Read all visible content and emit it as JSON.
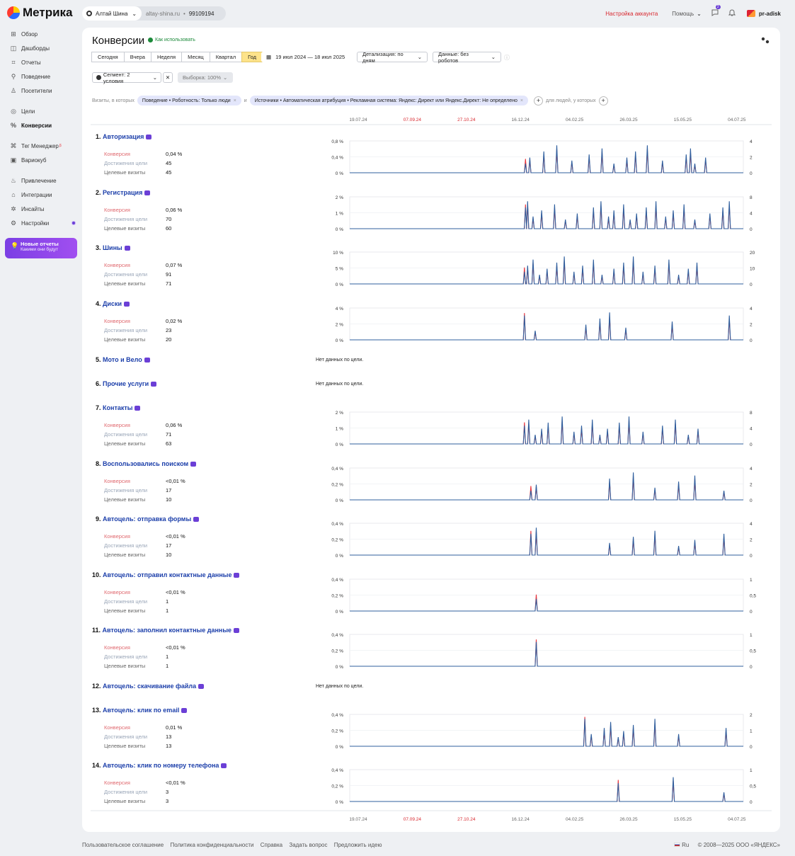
{
  "app": {
    "name": "Метрика"
  },
  "counter": {
    "name": "Алтай Шина",
    "domain": "altay-shina.ru",
    "id": "99109194"
  },
  "top": {
    "account_settings": "Настройка аккаунта",
    "help": "Помощь",
    "notif_count": "2",
    "user": "pr-adisk"
  },
  "sidebar": {
    "items": [
      {
        "label": "Обзор",
        "icon": "grid-icon"
      },
      {
        "label": "Дашборды",
        "icon": "dashboard-icon"
      },
      {
        "label": "Отчеты",
        "icon": "reports-icon"
      },
      {
        "label": "Поведение",
        "icon": "behavior-icon"
      },
      {
        "label": "Посетители",
        "icon": "visitors-icon"
      },
      {
        "label": "Цели",
        "icon": "target-icon"
      },
      {
        "label": "Конверсии",
        "icon": "percent-icon"
      },
      {
        "label": "Тег Менеджер",
        "icon": "tag-icon"
      },
      {
        "label": "Вариокуб",
        "icon": "cube-icon"
      },
      {
        "label": "Привлечение",
        "icon": "flame-icon"
      },
      {
        "label": "Интеграции",
        "icon": "integrations-icon"
      },
      {
        "label": "Инсайты",
        "icon": "insights-icon"
      },
      {
        "label": "Настройки",
        "icon": "gear-icon"
      }
    ],
    "promo": {
      "title": "Новые отчеты",
      "subtitle": "Какими они будут"
    }
  },
  "page": {
    "title": "Конверсии",
    "howto": "Как использовать"
  },
  "periods": [
    "Сегодня",
    "Вчера",
    "Неделя",
    "Месяц",
    "Квартал",
    "Год"
  ],
  "period_active": "Год",
  "date_range": "19 июл 2024 — 18 июл 2025",
  "detail": "Детализация: по дням",
  "data_mode": "Данные: без роботов",
  "segment": "Сегмент: 2 условия",
  "sample": "Выборка: 100%",
  "filters": {
    "prefix": "Визиты, в которых",
    "chip1": "Поведение • Роботность: Только люди",
    "and": "и",
    "chip2": "Источники • Автоматическая атрибуция • Рекламная система: Яндекс: Директ или Яндекс.Директ: Не определено",
    "people": "для людей, у которых"
  },
  "axis_dates": [
    "19.07.24",
    "07.09.24",
    "27.10.24",
    "16.12.24",
    "04.02.25",
    "26.03.25",
    "15.05.25",
    "04.07.25"
  ],
  "metric_labels": {
    "conv": "Конверсия",
    "reach": "Достижения цели",
    "visits": "Целевые визиты"
  },
  "no_data": "Нет данных по цели.",
  "goals": [
    {
      "num": "1.",
      "name": "Авторизация",
      "conv": "0,04 %",
      "reach": "45",
      "visits": "45",
      "left_ticks": [
        "0,8 %",
        "0,4 %",
        "0 %"
      ],
      "right_ticks": [
        "4",
        "2",
        "0"
      ]
    },
    {
      "num": "2.",
      "name": "Регистрация",
      "conv": "0,06 %",
      "reach": "70",
      "visits": "60",
      "left_ticks": [
        "2 %",
        "1 %",
        "0 %"
      ],
      "right_ticks": [
        "8",
        "4",
        "0"
      ]
    },
    {
      "num": "3.",
      "name": "Шины",
      "conv": "0,07 %",
      "reach": "91",
      "visits": "71",
      "left_ticks": [
        "10 %",
        "5 %",
        "0 %"
      ],
      "right_ticks": [
        "20",
        "10",
        "0"
      ]
    },
    {
      "num": "4.",
      "name": "Диски",
      "conv": "0,02 %",
      "reach": "23",
      "visits": "20",
      "left_ticks": [
        "4 %",
        "2 %",
        "0 %"
      ],
      "right_ticks": [
        "4",
        "2",
        "0"
      ]
    },
    {
      "num": "5.",
      "name": "Мото и Вело"
    },
    {
      "num": "6.",
      "name": "Прочие услуги"
    },
    {
      "num": "7.",
      "name": "Контакты",
      "conv": "0,06 %",
      "reach": "71",
      "visits": "63",
      "left_ticks": [
        "2 %",
        "1 %",
        "0 %"
      ],
      "right_ticks": [
        "8",
        "4",
        "0"
      ]
    },
    {
      "num": "8.",
      "name": "Воспользовались поиском",
      "conv": "<0,01 %",
      "reach": "17",
      "visits": "10",
      "left_ticks": [
        "0,4 %",
        "0,2 %",
        "0 %"
      ],
      "right_ticks": [
        "4",
        "2",
        "0"
      ]
    },
    {
      "num": "9.",
      "name": "Автоцель: отправка формы",
      "conv": "<0,01 %",
      "reach": "17",
      "visits": "10",
      "left_ticks": [
        "0,4 %",
        "0,2 %",
        "0 %"
      ],
      "right_ticks": [
        "4",
        "2",
        "0"
      ]
    },
    {
      "num": "10.",
      "name": "Автоцель: отправил контактные данные",
      "conv": "<0,01 %",
      "reach": "1",
      "visits": "1",
      "left_ticks": [
        "0,4 %",
        "0,2 %",
        "0 %"
      ],
      "right_ticks": [
        "1",
        "0,5",
        "0"
      ]
    },
    {
      "num": "11.",
      "name": "Автоцель: заполнил контактные данные",
      "conv": "<0,01 %",
      "reach": "1",
      "visits": "1",
      "left_ticks": [
        "0,4 %",
        "0,2 %",
        "0 %"
      ],
      "right_ticks": [
        "1",
        "0,5",
        "0"
      ]
    },
    {
      "num": "12.",
      "name": "Автоцель: скачивание файла"
    },
    {
      "num": "13.",
      "name": "Автоцель: клик по email",
      "conv": "0,01 %",
      "reach": "13",
      "visits": "13",
      "left_ticks": [
        "0,4 %",
        "0,2 %",
        "0 %"
      ],
      "right_ticks": [
        "2",
        "1",
        "0"
      ]
    },
    {
      "num": "14.",
      "name": "Автоцель: клик по номеру телефона",
      "conv": "<0,01 %",
      "reach": "3",
      "visits": "3",
      "left_ticks": [
        "0,4 %",
        "0,2 %",
        "0 %"
      ],
      "right_ticks": [
        "1",
        "0,5",
        "0"
      ]
    }
  ],
  "chart_data": {
    "type": "line",
    "x_range": [
      "19.07.24",
      "18.07.25"
    ],
    "series_colors": {
      "conversion": "#e8343c",
      "goal_visits": "#2f5f9e"
    },
    "spikes_days": [
      [
        163,
        167,
        180,
        192,
        206,
        222,
        234,
        245,
        257,
        265,
        276,
        290,
        312,
        316,
        320,
        330
      ],
      [
        163,
        165,
        170,
        178,
        190,
        200,
        211,
        226,
        233,
        240,
        245,
        254,
        260,
        266,
        275,
        284,
        293,
        300,
        310,
        320,
        334,
        346,
        352
      ],
      [
        162,
        165,
        170,
        176,
        183,
        192,
        199,
        208,
        216,
        226,
        234,
        245,
        254,
        263,
        272,
        283,
        296,
        305,
        314,
        322
      ],
      [
        162,
        172,
        219,
        232,
        241,
        256,
        299,
        352
      ],
      [],
      [],
      [
        162,
        166,
        172,
        178,
        184,
        197,
        208,
        215,
        225,
        232,
        239,
        250,
        259,
        272,
        290,
        302,
        314,
        323
      ],
      [
        168,
        173,
        241,
        263,
        283,
        305,
        320,
        347
      ],
      [
        168,
        173,
        241,
        263,
        283,
        305,
        320,
        347
      ],
      [
        173
      ],
      [
        173
      ],
      [],
      [
        218,
        224,
        236,
        242,
        249,
        254,
        263,
        283,
        305,
        349
      ],
      [
        249,
        300,
        347
      ]
    ]
  },
  "footer": {
    "links": [
      "Пользовательское соглашение",
      "Политика конфиденциальности",
      "Справка",
      "Задать вопрос",
      "Предложить идею"
    ],
    "lang": "Ru",
    "copy": "© 2008—2025 ООО «ЯНДЕКС»"
  }
}
